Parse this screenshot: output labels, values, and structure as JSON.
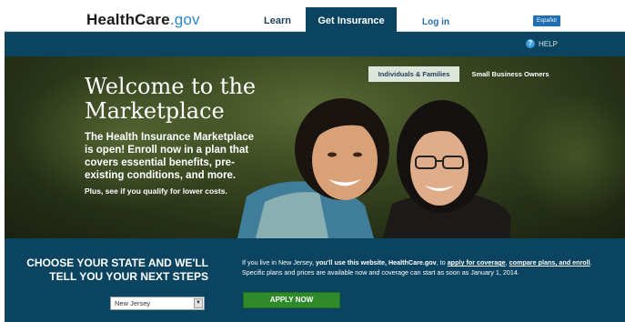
{
  "header": {
    "logo_health": "Health",
    "logo_care": "Care",
    "logo_gov": ".gov",
    "nav": {
      "learn": "Learn",
      "get_insurance": "Get Insurance",
      "login": "Log in",
      "espanol": "Español"
    }
  },
  "subbar": {
    "help": "HELP",
    "help_icon": "question-circle"
  },
  "hero": {
    "title": "Welcome to the Marketplace",
    "body": "The Health Insurance Marketplace is open! Enroll now in a plan that covers essential benefits, pre-existing conditions, and more.",
    "sub": "Plus, see if you qualify for lower costs.",
    "tabs": {
      "individuals": "Individuals & Families",
      "small_business": "Small Business Owners"
    }
  },
  "state_section": {
    "heading": "CHOOSE YOUR STATE AND WE'LL TELL YOU YOUR NEXT STEPS",
    "selected_state": "New Jersey",
    "info_pre": "If you live in New Jersey, ",
    "info_bold": "you'll use this website, HealthCare.gov",
    "info_mid1": ", to ",
    "link_apply": "apply for coverage",
    "info_comma": ", ",
    "link_compare": "compare plans, and enroll",
    "info_post": ". Specific plans and prices are available now and coverage can start as soon as January 1, 2014.",
    "apply_button": "APPLY NOW"
  },
  "colors": {
    "navy": "#0b4460",
    "accent_blue": "#2c87c9",
    "apply_green": "#2f8a2a"
  }
}
